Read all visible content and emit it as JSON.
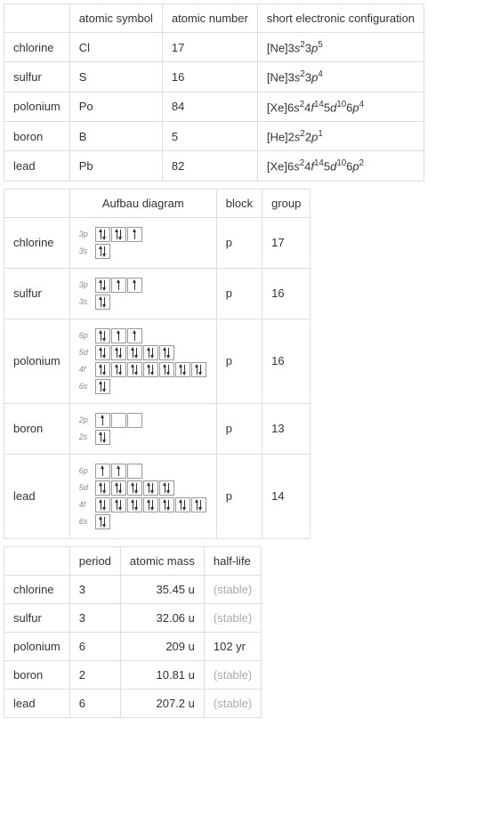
{
  "table1": {
    "headers": {
      "symbol": "atomic symbol",
      "number": "atomic number",
      "config": "short electronic configuration"
    },
    "rows": [
      {
        "name": "chlorine",
        "symbol": "Cl",
        "number": "17",
        "config_base": "[Ne]3",
        "config_parts": [
          [
            "s",
            "2"
          ],
          [
            "3p",
            "5"
          ]
        ]
      },
      {
        "name": "sulfur",
        "symbol": "S",
        "number": "16",
        "config_base": "[Ne]3",
        "config_parts": [
          [
            "s",
            "2"
          ],
          [
            "3p",
            "4"
          ]
        ]
      },
      {
        "name": "polonium",
        "symbol": "Po",
        "number": "84",
        "config_base": "[Xe]6",
        "config_parts": [
          [
            "s",
            "2"
          ],
          [
            "4f",
            "14"
          ],
          [
            "5d",
            "10"
          ],
          [
            "6p",
            "4"
          ]
        ]
      },
      {
        "name": "boron",
        "symbol": "B",
        "number": "5",
        "config_base": "[He]2",
        "config_parts": [
          [
            "s",
            "2"
          ],
          [
            "2p",
            "1"
          ]
        ]
      },
      {
        "name": "lead",
        "symbol": "Pb",
        "number": "82",
        "config_base": "[Xe]6",
        "config_parts": [
          [
            "s",
            "2"
          ],
          [
            "4f",
            "14"
          ],
          [
            "5d",
            "10"
          ],
          [
            "6p",
            "2"
          ]
        ]
      }
    ]
  },
  "table2": {
    "headers": {
      "aufbau": "Aufbau diagram",
      "block": "block",
      "group": "group"
    },
    "rows": [
      {
        "name": "chlorine",
        "block": "p",
        "group": "17",
        "orbitals": [
          {
            "label": "3p",
            "boxes": [
              2,
              2,
              1
            ]
          },
          {
            "label": "3s",
            "boxes": [
              2
            ]
          }
        ]
      },
      {
        "name": "sulfur",
        "block": "p",
        "group": "16",
        "orbitals": [
          {
            "label": "3p",
            "boxes": [
              2,
              1,
              1
            ]
          },
          {
            "label": "3s",
            "boxes": [
              2
            ]
          }
        ]
      },
      {
        "name": "polonium",
        "block": "p",
        "group": "16",
        "orbitals": [
          {
            "label": "6p",
            "boxes": [
              2,
              1,
              1
            ]
          },
          {
            "label": "5d",
            "boxes": [
              2,
              2,
              2,
              2,
              2
            ]
          },
          {
            "label": "4f",
            "boxes": [
              2,
              2,
              2,
              2,
              2,
              2,
              2
            ]
          },
          {
            "label": "6s",
            "boxes": [
              2
            ]
          }
        ]
      },
      {
        "name": "boron",
        "block": "p",
        "group": "13",
        "orbitals": [
          {
            "label": "2p",
            "boxes": [
              1,
              0,
              0
            ]
          },
          {
            "label": "2s",
            "boxes": [
              2
            ]
          }
        ]
      },
      {
        "name": "lead",
        "block": "p",
        "group": "14",
        "orbitals": [
          {
            "label": "6p",
            "boxes": [
              1,
              1,
              0
            ]
          },
          {
            "label": "5d",
            "boxes": [
              2,
              2,
              2,
              2,
              2
            ]
          },
          {
            "label": "4f",
            "boxes": [
              2,
              2,
              2,
              2,
              2,
              2,
              2
            ]
          },
          {
            "label": "6s",
            "boxes": [
              2
            ]
          }
        ]
      }
    ]
  },
  "table3": {
    "headers": {
      "period": "period",
      "mass": "atomic mass",
      "halflife": "half-life"
    },
    "rows": [
      {
        "name": "chlorine",
        "period": "3",
        "mass": "35.45 u",
        "halflife": "(stable)",
        "stable": true
      },
      {
        "name": "sulfur",
        "period": "3",
        "mass": "32.06 u",
        "halflife": "(stable)",
        "stable": true
      },
      {
        "name": "polonium",
        "period": "6",
        "mass": "209 u",
        "halflife": "102 yr",
        "stable": false
      },
      {
        "name": "boron",
        "period": "2",
        "mass": "10.81 u",
        "halflife": "(stable)",
        "stable": true
      },
      {
        "name": "lead",
        "period": "6",
        "mass": "207.2 u",
        "halflife": "(stable)",
        "stable": true
      }
    ]
  }
}
